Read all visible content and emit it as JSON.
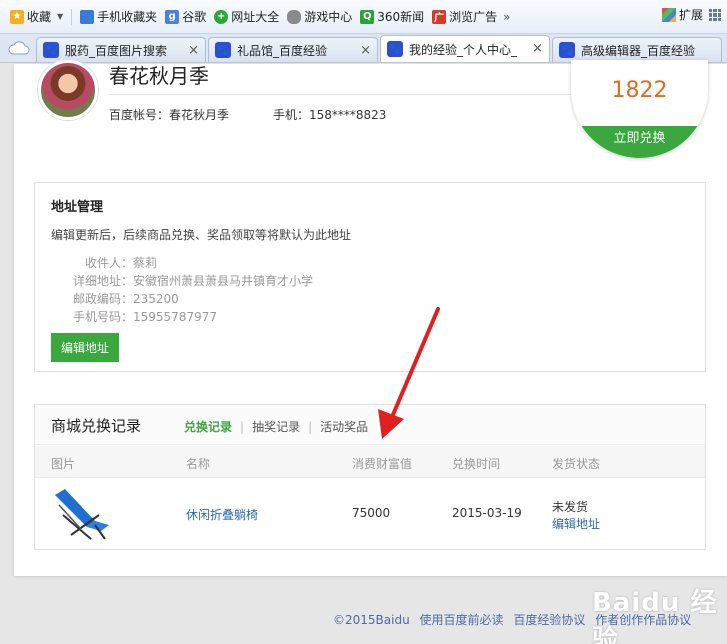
{
  "bookmarks": [
    {
      "label": "收藏",
      "icon": "star-icon"
    },
    {
      "label": "手机收藏夹",
      "icon": "phone-icon"
    },
    {
      "label": "谷歌",
      "icon": "google-icon"
    },
    {
      "label": "网址大全",
      "icon": "sites-icon"
    },
    {
      "label": "游戏中心",
      "icon": "gamepad-icon"
    },
    {
      "label": "360新闻",
      "icon": "news-icon"
    },
    {
      "label": "浏览广告",
      "icon": "ad-icon"
    }
  ],
  "bookmarks_more": "»",
  "extensions_label": "扩展",
  "tabs": [
    {
      "title": "服药_百度图片搜索",
      "active": false
    },
    {
      "title": "礼品馆_百度经验",
      "active": false
    },
    {
      "title": "我的经验_个人中心_",
      "active": true
    },
    {
      "title": "高级编辑器_百度经验",
      "active": false
    }
  ],
  "tab_close": "×",
  "user": {
    "name": "春花秋月季",
    "account_label": "百度帐号：春花秋月季",
    "phone_label": "手机：158****8823"
  },
  "points": {
    "value": "1822",
    "redeem_label": "立即兑换"
  },
  "address": {
    "heading": "地址管理",
    "hint": "编辑更新后，后续商品兑换、奖品领取等将默认为此地址",
    "fields": [
      {
        "key": "收件人：",
        "value": "蔡莉"
      },
      {
        "key": "详细地址：",
        "value": "安徽宿州萧县萧县马井镇育才小学"
      },
      {
        "key": "邮政编码：",
        "value": "235200"
      },
      {
        "key": "手机号码：",
        "value": "15955787977"
      }
    ],
    "edit_button": "编辑地址"
  },
  "mall": {
    "title": "商城兑换记录",
    "tabs": [
      {
        "label": "兑换记录",
        "active": true
      },
      {
        "label": "抽奖记录",
        "active": false
      },
      {
        "label": "活动奖品",
        "active": false
      }
    ],
    "tab_separator": "|",
    "columns": [
      "图片",
      "名称",
      "消费财富值",
      "兑换时间",
      "发货状态"
    ],
    "rows": [
      {
        "name": "休闲折叠躺椅",
        "cost": "75000",
        "date": "2015-03-19",
        "status": "未发货",
        "action": "编辑地址"
      }
    ]
  },
  "footer": {
    "copyright": "©2015Baidu",
    "links": [
      "使用百度前必读",
      "百度经验协议",
      "作者创作作品协议"
    ]
  },
  "watermark": "Baidu 经验",
  "colors": {
    "accent_green": "#3aa83f",
    "points_orange": "#e16b1c",
    "link_blue": "#2a6ab0"
  }
}
